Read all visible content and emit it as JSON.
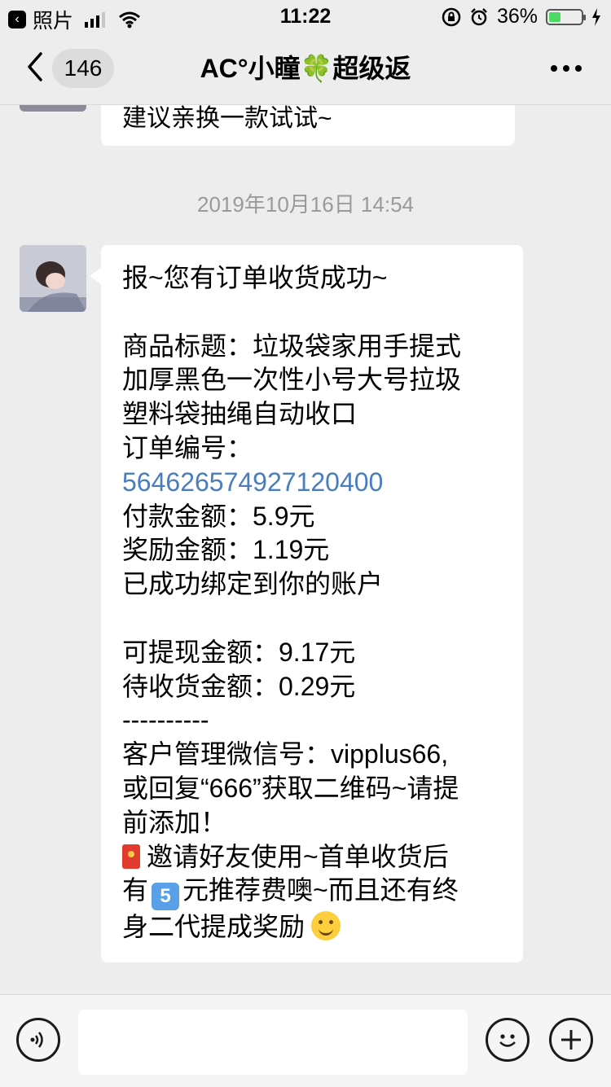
{
  "status_bar": {
    "back_app_label": "照片",
    "time": "11:22",
    "battery_percent_text": "36%",
    "battery_level": 0.36,
    "icons": [
      "back-app-icon",
      "signal-icon",
      "wifi-icon",
      "orientation-lock-icon",
      "alarm-icon",
      "battery-icon",
      "charging-icon"
    ]
  },
  "nav": {
    "unread_count": "146",
    "title": "AC°小瞳🍀超级返",
    "icons": [
      "chevron-left-icon",
      "more-icon"
    ]
  },
  "chat": {
    "previous_message_tail": "建议亲换一款试试~",
    "timestamp": "2019年10月16日 14:54",
    "message": {
      "lines": [
        "报~您有订单收货成功~",
        "",
        "商品标题：垃圾袋家用手提式",
        "加厚黑色一次性小号大号拉圾",
        "塑料袋抽绳自动收口",
        "订单编号：",
        "564626574927120400",
        "付款金额：5.9元",
        "奖励金额：1.19元",
        "已成功绑定到你的账户",
        "",
        "可提现金额：9.17元",
        "待收货金额：0.29元",
        "----------",
        "客户管理微信号：vipplus66,",
        "或回复“666”获取二维码~请提",
        "前添加！",
        "邀请好友使用~首单收货后",
        "有",
        "元推荐费噢~而且还有终",
        "身二代提成奖励"
      ],
      "emoji_five": "5",
      "emoji_icons": [
        "red-envelope-icon",
        "keycap-five-icon",
        "smile-emoji-icon"
      ]
    }
  },
  "input_bar": {
    "placeholder": "",
    "icons": [
      "voice-icon",
      "emoji-icon",
      "plus-icon"
    ]
  }
}
